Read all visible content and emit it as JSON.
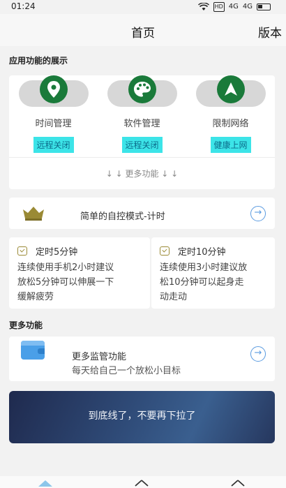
{
  "status_bar": {
    "time": "01:24",
    "signal1": "4G",
    "signal2": "4G"
  },
  "nav": {
    "title": "首页",
    "version": "版本"
  },
  "section_app": {
    "label": "应用功能的展示"
  },
  "apps": [
    {
      "name": "时间管理",
      "tag": "远程关闭",
      "icon": "location-pin-icon"
    },
    {
      "name": "软件管理",
      "tag": "远程关闭",
      "icon": "palette-icon"
    },
    {
      "name": "限制网络",
      "tag": "健康上网",
      "icon": "navigation-arrow-icon"
    }
  ],
  "more_functions_link": "↓ ↓ 更多功能 ↓ ↓",
  "mode_card": {
    "text": "简单的自控模式-计时"
  },
  "timers": [
    {
      "title": "定时5分钟",
      "body": [
        "连续使用手机2小时建议",
        "放松5分钟可以伸展一下",
        "缓解疲劳"
      ]
    },
    {
      "title": "定时10分钟",
      "body": [
        "连续使用3小时建议放",
        "松10分钟可以起身走",
        "动走动"
      ]
    }
  ],
  "section_more": {
    "label": "更多功能"
  },
  "monitor_card": {
    "title": "更多监管功能",
    "subtitle": "每天给自己一个放松小目标"
  },
  "banner": {
    "text": "到底线了，不要再下拉了"
  },
  "colors": {
    "accent_green": "#1a7a3a",
    "tag_cyan": "#3ce4e8",
    "tag_text": "#0b6b8a",
    "arrow_blue": "#5a9be0"
  }
}
